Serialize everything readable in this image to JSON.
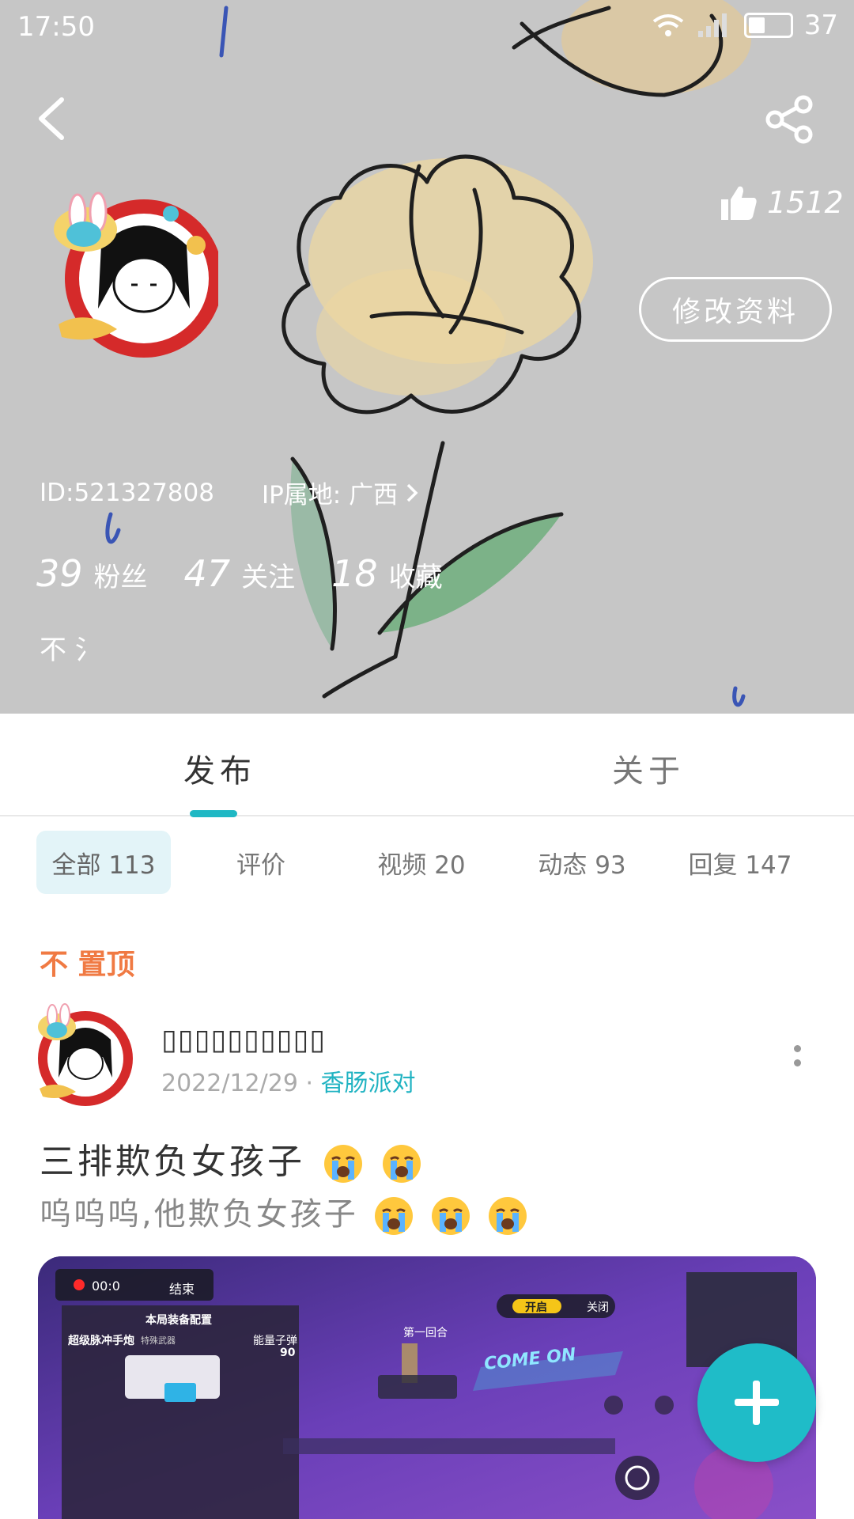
{
  "status_bar": {
    "time": "17:50",
    "battery": "37"
  },
  "header": {
    "likes": "1512",
    "edit_button": "修改资料",
    "id_text": "ID:521327808",
    "ip_text": "IP属地: 广西",
    "stats": [
      {
        "num": "39",
        "label": "粉丝"
      },
      {
        "num": "47",
        "label": "关注"
      },
      {
        "num": "18",
        "label": "收藏"
      }
    ],
    "bio": "不 氵"
  },
  "tabs": [
    {
      "label": "发布",
      "active": true
    },
    {
      "label": "关于",
      "active": false
    }
  ],
  "filters": [
    {
      "label": "全部 113",
      "active": true
    },
    {
      "label": "评价",
      "active": false
    },
    {
      "label": "视频 20",
      "active": false
    },
    {
      "label": "动态 93",
      "active": false
    },
    {
      "label": "回复 147",
      "active": false
    }
  ],
  "post": {
    "pinned_label": "不 置顶",
    "author": "▯▯▯▯▯▯▯▯▯▯",
    "date": "2022/12/29",
    "separator": "·",
    "game": "香肠派对",
    "title": "三排欺负女孩子",
    "body": "呜呜呜,他欺负女孩子",
    "image": {
      "rec_time": "00:0",
      "end": "结束",
      "config": "本局装备配置",
      "weapon": "超级脉冲手炮",
      "weapon_type": "特殊武器",
      "ammo": "能量子弹",
      "ammo_count": "90",
      "on": "开启",
      "off": "关闭",
      "round": "第一回合",
      "banner": "COME ON"
    }
  },
  "colors": {
    "accent": "#1fb8c4",
    "pinned": "#f07a43",
    "chip_bg": "#e3f4f8"
  }
}
